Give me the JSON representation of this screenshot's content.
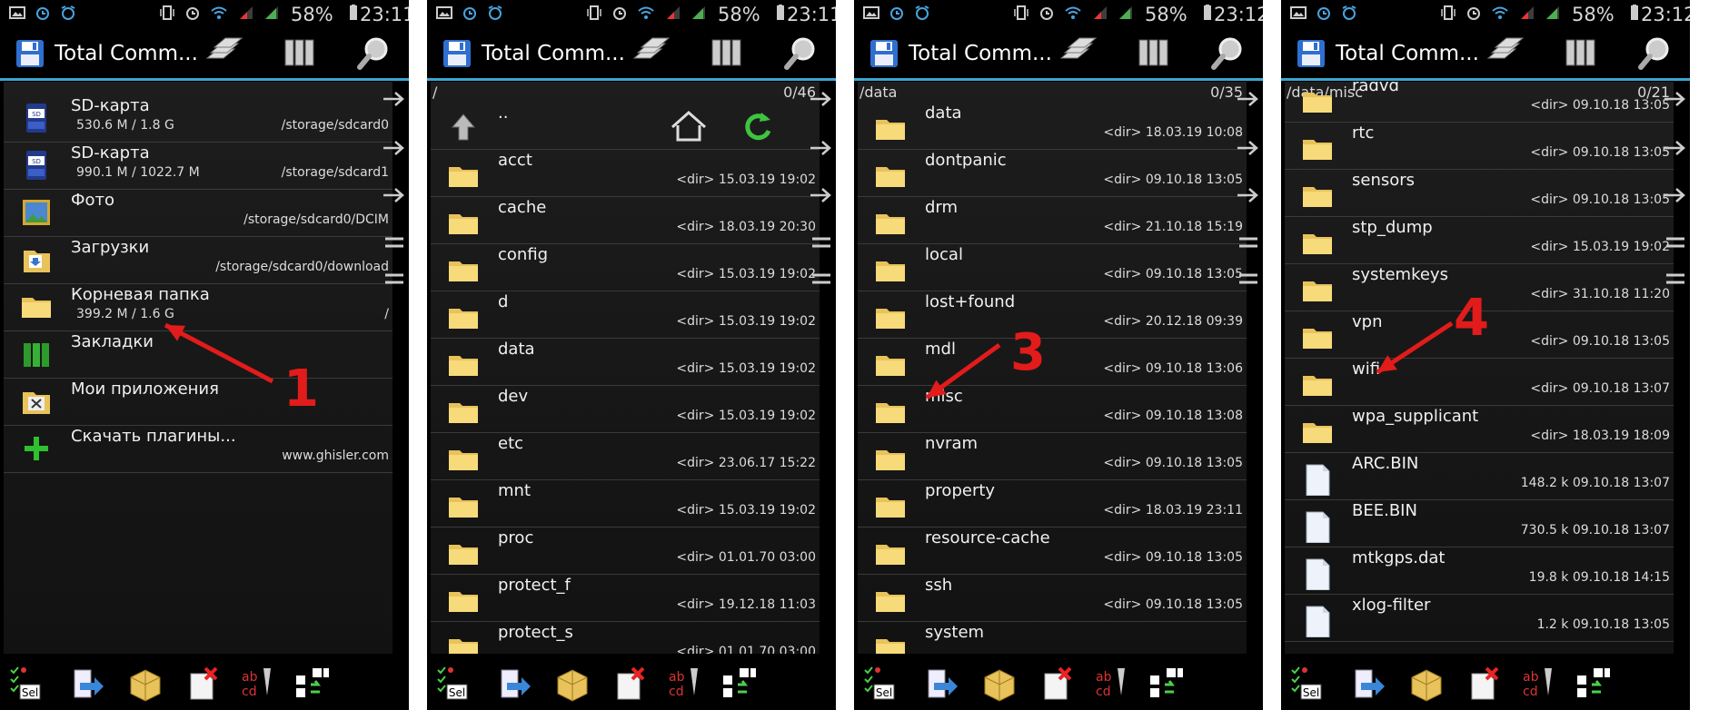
{
  "screens": [
    {
      "status": {
        "battery": "58%",
        "time": "23:11"
      },
      "title": "Total Comm...",
      "rows": [
        {
          "name": "SD-карта",
          "size": "530.6 M / 1.8 G",
          "info": "/storage/sdcard0",
          "icon": "sd-card-icon"
        },
        {
          "name": "SD-карта",
          "size": "990.1 M / 1022.7 M",
          "info": "/storage/sdcard1",
          "icon": "sd-card-icon"
        },
        {
          "name": "Фото",
          "size": "",
          "info": "/storage/sdcard0/DCIM",
          "icon": "photo-icon"
        },
        {
          "name": "Загрузки",
          "size": "",
          "info": "/storage/sdcard0/download",
          "icon": "downloads-icon"
        },
        {
          "name": "Корневая папка",
          "size": "399.2 M / 1.6 G",
          "info": "/",
          "icon": "folder-icon"
        },
        {
          "name": "Закладки",
          "size": "",
          "info": "",
          "icon": "bookmarks-icon"
        },
        {
          "name": "Мои приложения",
          "size": "",
          "info": "",
          "icon": "apps-icon"
        },
        {
          "name": "Скачать плагины...",
          "size": "",
          "info": "www.ghisler.com",
          "icon": "plus-icon"
        }
      ],
      "step": "1"
    },
    {
      "status": {
        "battery": "58%",
        "time": "23:11"
      },
      "title": "Total Comm...",
      "path": "/",
      "count": "0/46",
      "up": "..",
      "rows": [
        {
          "name": "acct",
          "info": "<dir> 15.03.19 19:02"
        },
        {
          "name": "cache",
          "info": "<dir> 18.03.19 20:30"
        },
        {
          "name": "config",
          "info": "<dir> 15.03.19 19:02"
        },
        {
          "name": "d",
          "info": "<dir> 15.03.19 19:02"
        },
        {
          "name": "data",
          "info": "<dir> 15.03.19 19:02"
        },
        {
          "name": "dev",
          "info": "<dir> 15.03.19 19:02"
        },
        {
          "name": "etc",
          "info": "<dir> 23.06.17 15:22"
        },
        {
          "name": "mnt",
          "info": "<dir> 15.03.19 19:02"
        },
        {
          "name": "proc",
          "info": "<dir> 01.01.70 03:00"
        },
        {
          "name": "protect_f",
          "info": "<dir> 19.12.18 11:03"
        },
        {
          "name": "protect_s",
          "info": "<dir> 01.01.70 03:00"
        }
      ],
      "step": "2"
    },
    {
      "status": {
        "battery": "58%",
        "time": "23:12"
      },
      "title": "Total Comm...",
      "path": "/data",
      "count": "0/35",
      "rows": [
        {
          "name": "data",
          "info": "<dir> 18.03.19 10:08"
        },
        {
          "name": "dontpanic",
          "info": "<dir> 09.10.18 13:05"
        },
        {
          "name": "drm",
          "info": "<dir> 21.10.18 15:19"
        },
        {
          "name": "local",
          "info": "<dir> 09.10.18 13:05"
        },
        {
          "name": "lost+found",
          "info": "<dir> 20.12.18 09:39"
        },
        {
          "name": "mdl",
          "info": "<dir> 09.10.18 13:06"
        },
        {
          "name": "misc",
          "info": "<dir> 09.10.18 13:08"
        },
        {
          "name": "nvram",
          "info": "<dir> 09.10.18 13:05"
        },
        {
          "name": "property",
          "info": "<dir> 18.03.19 23:11"
        },
        {
          "name": "resource-cache",
          "info": "<dir> 09.10.18 13:05"
        },
        {
          "name": "ssh",
          "info": "<dir> 09.10.18 13:05"
        },
        {
          "name": "system",
          "info": ""
        }
      ],
      "step": "3"
    },
    {
      "status": {
        "battery": "58%",
        "time": "23:12"
      },
      "title": "Total Comm...",
      "path": "/data/misc",
      "count": "0/21",
      "rows": [
        {
          "name": "radvd",
          "info": "<dir> 09.10.18 13:05",
          "icon": "folder-icon"
        },
        {
          "name": "rtc",
          "info": "<dir> 09.10.18 13:05",
          "icon": "folder-icon"
        },
        {
          "name": "sensors",
          "info": "<dir> 09.10.18 13:05",
          "icon": "folder-icon"
        },
        {
          "name": "stp_dump",
          "info": "<dir> 15.03.19 19:02",
          "icon": "folder-icon"
        },
        {
          "name": "systemkeys",
          "info": "<dir> 31.10.18 11:20",
          "icon": "folder-icon"
        },
        {
          "name": "vpn",
          "info": "<dir> 09.10.18 13:05",
          "icon": "folder-icon"
        },
        {
          "name": "wifi",
          "info": "<dir> 09.10.18 13:07",
          "icon": "folder-icon"
        },
        {
          "name": "wpa_supplicant",
          "info": "<dir> 18.03.19 18:09",
          "icon": "folder-icon"
        },
        {
          "name": "ARC.BIN",
          "info": "148.2 k 09.10.18 13:07",
          "icon": "file-icon"
        },
        {
          "name": "BEE.BIN",
          "info": "730.5 k 09.10.18 13:07",
          "icon": "file-icon"
        },
        {
          "name": "mtkgps.dat",
          "info": "19.8 k 09.10.18 14:15",
          "icon": "file-icon"
        },
        {
          "name": "xlog-filter",
          "info": "1.2 k 09.10.18 13:05",
          "icon": "file-icon"
        }
      ],
      "step": "4"
    }
  ],
  "toolbar_labels": {
    "select": "Sel",
    "rename_top": "ab",
    "rename_bot": "cd"
  }
}
